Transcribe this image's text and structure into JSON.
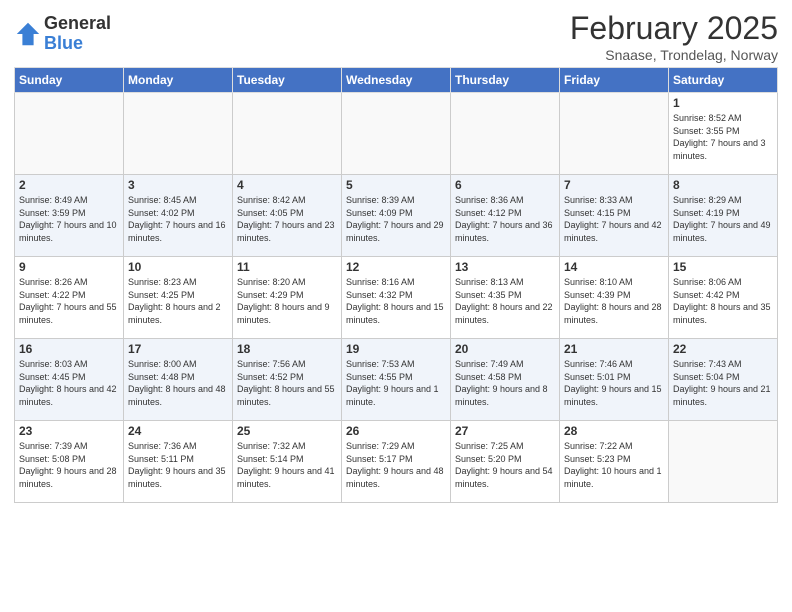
{
  "logo": {
    "general": "General",
    "blue": "Blue"
  },
  "header": {
    "month": "February 2025",
    "location": "Snaase, Trondelag, Norway"
  },
  "weekdays": [
    "Sunday",
    "Monday",
    "Tuesday",
    "Wednesday",
    "Thursday",
    "Friday",
    "Saturday"
  ],
  "weeks": [
    [
      {
        "day": "",
        "info": ""
      },
      {
        "day": "",
        "info": ""
      },
      {
        "day": "",
        "info": ""
      },
      {
        "day": "",
        "info": ""
      },
      {
        "day": "",
        "info": ""
      },
      {
        "day": "",
        "info": ""
      },
      {
        "day": "1",
        "info": "Sunrise: 8:52 AM\nSunset: 3:55 PM\nDaylight: 7 hours and 3 minutes."
      }
    ],
    [
      {
        "day": "2",
        "info": "Sunrise: 8:49 AM\nSunset: 3:59 PM\nDaylight: 7 hours and 10 minutes."
      },
      {
        "day": "3",
        "info": "Sunrise: 8:45 AM\nSunset: 4:02 PM\nDaylight: 7 hours and 16 minutes."
      },
      {
        "day": "4",
        "info": "Sunrise: 8:42 AM\nSunset: 4:05 PM\nDaylight: 7 hours and 23 minutes."
      },
      {
        "day": "5",
        "info": "Sunrise: 8:39 AM\nSunset: 4:09 PM\nDaylight: 7 hours and 29 minutes."
      },
      {
        "day": "6",
        "info": "Sunrise: 8:36 AM\nSunset: 4:12 PM\nDaylight: 7 hours and 36 minutes."
      },
      {
        "day": "7",
        "info": "Sunrise: 8:33 AM\nSunset: 4:15 PM\nDaylight: 7 hours and 42 minutes."
      },
      {
        "day": "8",
        "info": "Sunrise: 8:29 AM\nSunset: 4:19 PM\nDaylight: 7 hours and 49 minutes."
      }
    ],
    [
      {
        "day": "9",
        "info": "Sunrise: 8:26 AM\nSunset: 4:22 PM\nDaylight: 7 hours and 55 minutes."
      },
      {
        "day": "10",
        "info": "Sunrise: 8:23 AM\nSunset: 4:25 PM\nDaylight: 8 hours and 2 minutes."
      },
      {
        "day": "11",
        "info": "Sunrise: 8:20 AM\nSunset: 4:29 PM\nDaylight: 8 hours and 9 minutes."
      },
      {
        "day": "12",
        "info": "Sunrise: 8:16 AM\nSunset: 4:32 PM\nDaylight: 8 hours and 15 minutes."
      },
      {
        "day": "13",
        "info": "Sunrise: 8:13 AM\nSunset: 4:35 PM\nDaylight: 8 hours and 22 minutes."
      },
      {
        "day": "14",
        "info": "Sunrise: 8:10 AM\nSunset: 4:39 PM\nDaylight: 8 hours and 28 minutes."
      },
      {
        "day": "15",
        "info": "Sunrise: 8:06 AM\nSunset: 4:42 PM\nDaylight: 8 hours and 35 minutes."
      }
    ],
    [
      {
        "day": "16",
        "info": "Sunrise: 8:03 AM\nSunset: 4:45 PM\nDaylight: 8 hours and 42 minutes."
      },
      {
        "day": "17",
        "info": "Sunrise: 8:00 AM\nSunset: 4:48 PM\nDaylight: 8 hours and 48 minutes."
      },
      {
        "day": "18",
        "info": "Sunrise: 7:56 AM\nSunset: 4:52 PM\nDaylight: 8 hours and 55 minutes."
      },
      {
        "day": "19",
        "info": "Sunrise: 7:53 AM\nSunset: 4:55 PM\nDaylight: 9 hours and 1 minute."
      },
      {
        "day": "20",
        "info": "Sunrise: 7:49 AM\nSunset: 4:58 PM\nDaylight: 9 hours and 8 minutes."
      },
      {
        "day": "21",
        "info": "Sunrise: 7:46 AM\nSunset: 5:01 PM\nDaylight: 9 hours and 15 minutes."
      },
      {
        "day": "22",
        "info": "Sunrise: 7:43 AM\nSunset: 5:04 PM\nDaylight: 9 hours and 21 minutes."
      }
    ],
    [
      {
        "day": "23",
        "info": "Sunrise: 7:39 AM\nSunset: 5:08 PM\nDaylight: 9 hours and 28 minutes."
      },
      {
        "day": "24",
        "info": "Sunrise: 7:36 AM\nSunset: 5:11 PM\nDaylight: 9 hours and 35 minutes."
      },
      {
        "day": "25",
        "info": "Sunrise: 7:32 AM\nSunset: 5:14 PM\nDaylight: 9 hours and 41 minutes."
      },
      {
        "day": "26",
        "info": "Sunrise: 7:29 AM\nSunset: 5:17 PM\nDaylight: 9 hours and 48 minutes."
      },
      {
        "day": "27",
        "info": "Sunrise: 7:25 AM\nSunset: 5:20 PM\nDaylight: 9 hours and 54 minutes."
      },
      {
        "day": "28",
        "info": "Sunrise: 7:22 AM\nSunset: 5:23 PM\nDaylight: 10 hours and 1 minute."
      },
      {
        "day": "",
        "info": ""
      }
    ]
  ]
}
